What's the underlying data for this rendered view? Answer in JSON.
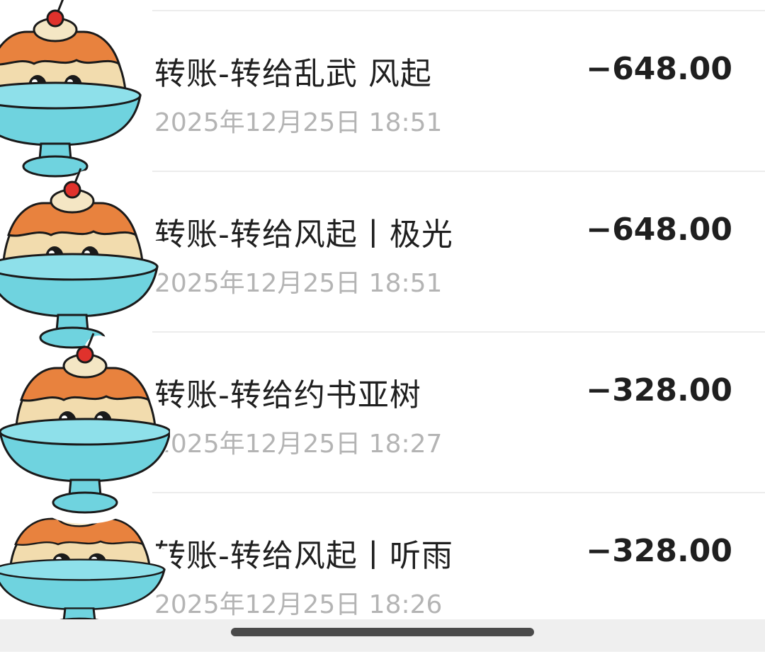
{
  "transactions": [
    {
      "title": "转账-转给乱武 风起",
      "time": "2025年12月25日 18:51",
      "amount": "−648.00"
    },
    {
      "title": "转账-转给风起丨极光",
      "time": "2025年12月25日 18:51",
      "amount": "−648.00"
    },
    {
      "title": "转账-转给约书亚树",
      "time": "2025年12月25日 18:27",
      "amount": "−328.00"
    },
    {
      "title": "转账-转给风起丨听雨",
      "time": "2025年12月25日 18:26",
      "amount": "−328.00"
    }
  ],
  "stickers": {
    "icon": "pudding-sticker-icon",
    "count": 4
  },
  "colors": {
    "title": "#1f1f1f",
    "time": "#b4b4b4",
    "amount": "#1f1f1f",
    "bowl": "#6fd3df",
    "pudding": "#f2dcae",
    "caramel": "#e8823e",
    "cherry": "#e0322c"
  }
}
